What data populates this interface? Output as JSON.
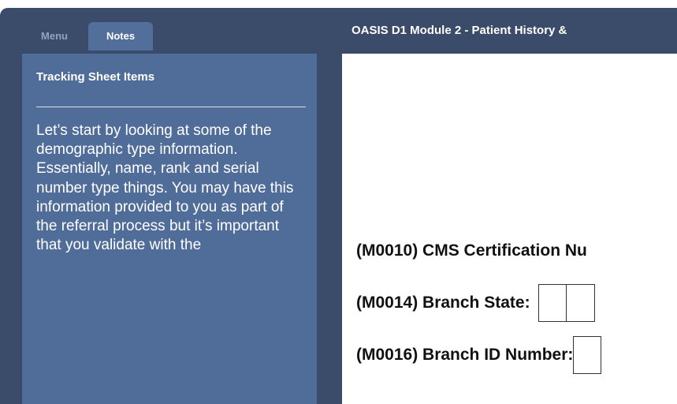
{
  "window": {
    "title": "OASIS D1 Module 2 - Patient History &"
  },
  "sidebar": {
    "tabs": [
      {
        "label": "Menu",
        "active": false
      },
      {
        "label": "Notes",
        "active": true
      }
    ],
    "notes": {
      "heading": "Tracking Sheet Items",
      "body": "Let’s start by looking at some of the demographic type information. Essentially, name, rank and serial number type things. You may have this information provided to you as part of the referral process but it’s important that you validate with the"
    }
  },
  "form": {
    "rows": [
      {
        "label": "(M0010) CMS Certification Nu"
      },
      {
        "label": "(M0014) Branch State:"
      },
      {
        "label": "(M0016) Branch ID Number:"
      }
    ]
  },
  "colors": {
    "frame": "#3a4c69",
    "notes_panel": "#506d99",
    "active_tab": "#516f9a",
    "inactive_tab_text": "#8fa3c6",
    "content_bg": "#ffffff"
  }
}
